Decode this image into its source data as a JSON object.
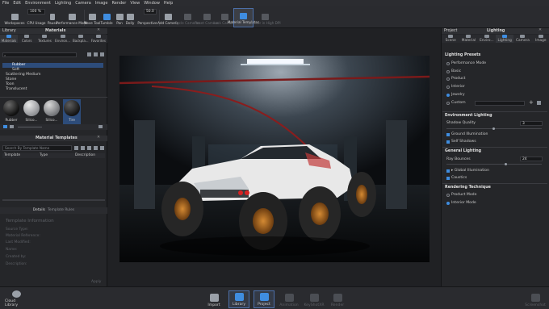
{
  "menu": [
    "File",
    "Edit",
    "Environment",
    "Lighting",
    "Camera",
    "Image",
    "Render",
    "View",
    "Window",
    "Help"
  ],
  "toolbar": {
    "workspace_label": "Workspaces",
    "cpu_label": "CPU Usage",
    "cpu_value": "100 %",
    "pause_label": "Pause",
    "performance_label": "Performance Mode",
    "movetool_label": "Move Tool",
    "tumble_label": "Tumble",
    "pan_label": "Pan",
    "dolly_label": "Dolly",
    "perspective_label": "Perspective",
    "perspective_value": "50.0",
    "addcamera_label": "Add Camera",
    "cyclecameras_label": "Cycle Cameras",
    "resetcamera_label": "Reset Camera",
    "lockcamera_label": "Lock Camera",
    "materialtemplates_label": "Material Templates",
    "renderinhighdpi_label": "Render in High DPI"
  },
  "library": {
    "panel_left": "Library",
    "panel_title": "Materials",
    "tabs": [
      "Materials",
      "Colors",
      "Textures",
      "Environ...",
      "Backpla...",
      "Favorites"
    ],
    "tree": [
      {
        "label": "Rubber",
        "selected": true,
        "indent": 1
      },
      {
        "label": "Soft",
        "selected": false,
        "indent": 1
      },
      {
        "label": "Scattering Medium",
        "selected": false,
        "indent": 0
      },
      {
        "label": "Stone",
        "selected": false,
        "indent": 0
      },
      {
        "label": "Toon",
        "selected": false,
        "indent": 0
      },
      {
        "label": "Translucent",
        "selected": false,
        "indent": 0
      }
    ],
    "thumbnails": [
      "Rubber",
      "Silico...",
      "Silico...",
      "Tire"
    ]
  },
  "templates": {
    "panel_title": "Material Templates",
    "search_placeholder": "Search By Template Name",
    "columns": [
      "Template",
      "Type",
      "Description"
    ],
    "tabs": [
      "Details",
      "Template Rules"
    ],
    "info_title": "Template Information",
    "fields": [
      "Source Type:",
      "Material Reference:",
      "Last Modified:",
      "Name:",
      "Created by:",
      "Description:"
    ],
    "apply_label": "Apply"
  },
  "right": {
    "panel_left": "Project",
    "panel_title": "Lighting",
    "tabs": [
      "Scene",
      "Material",
      "Enviro...",
      "Lighting",
      "Camera",
      "Image"
    ],
    "presets_title": "Lighting Presets",
    "presets": [
      {
        "label": "Performance Mode",
        "on": false
      },
      {
        "label": "Basic",
        "on": false
      },
      {
        "label": "Product",
        "on": false
      },
      {
        "label": "Interior",
        "on": false
      },
      {
        "label": "Jewelry",
        "on": true
      },
      {
        "label": "Custom",
        "on": false
      }
    ],
    "env_title": "Environment Lighting",
    "shadow_label": "Shadow Quality",
    "shadow_value": "3",
    "ground_label": "Ground Illumination",
    "selfshadow_label": "Self Shadows",
    "general_title": "General Lighting",
    "raybounces_label": "Ray Bounces",
    "raybounces_value": "24",
    "globalillum_label": "Global Illumination",
    "caustics_label": "Caustics",
    "rendering_title": "Rendering Technique",
    "technique": [
      {
        "label": "Product Mode",
        "on": false
      },
      {
        "label": "Interior Mode",
        "on": true
      }
    ]
  },
  "bottom": {
    "cloud_label": "Cloud Library",
    "buttons": [
      {
        "label": "Import",
        "active": false,
        "dim": false
      },
      {
        "label": "Library",
        "active": true,
        "dim": false
      },
      {
        "label": "Project",
        "active": true,
        "dim": false
      },
      {
        "label": "Animation",
        "active": false,
        "dim": true
      },
      {
        "label": "KeyShotXR",
        "active": false,
        "dim": true
      },
      {
        "label": "Render",
        "active": false,
        "dim": true
      }
    ],
    "screenshot_label": "Screenshot"
  },
  "colors": {
    "accent": "#3f8de0",
    "selection": "#2d4c7a",
    "panel": "#252629",
    "car_body": "#e8e8e8",
    "tire": "#2a2a2a",
    "rim": "#b8742a"
  }
}
